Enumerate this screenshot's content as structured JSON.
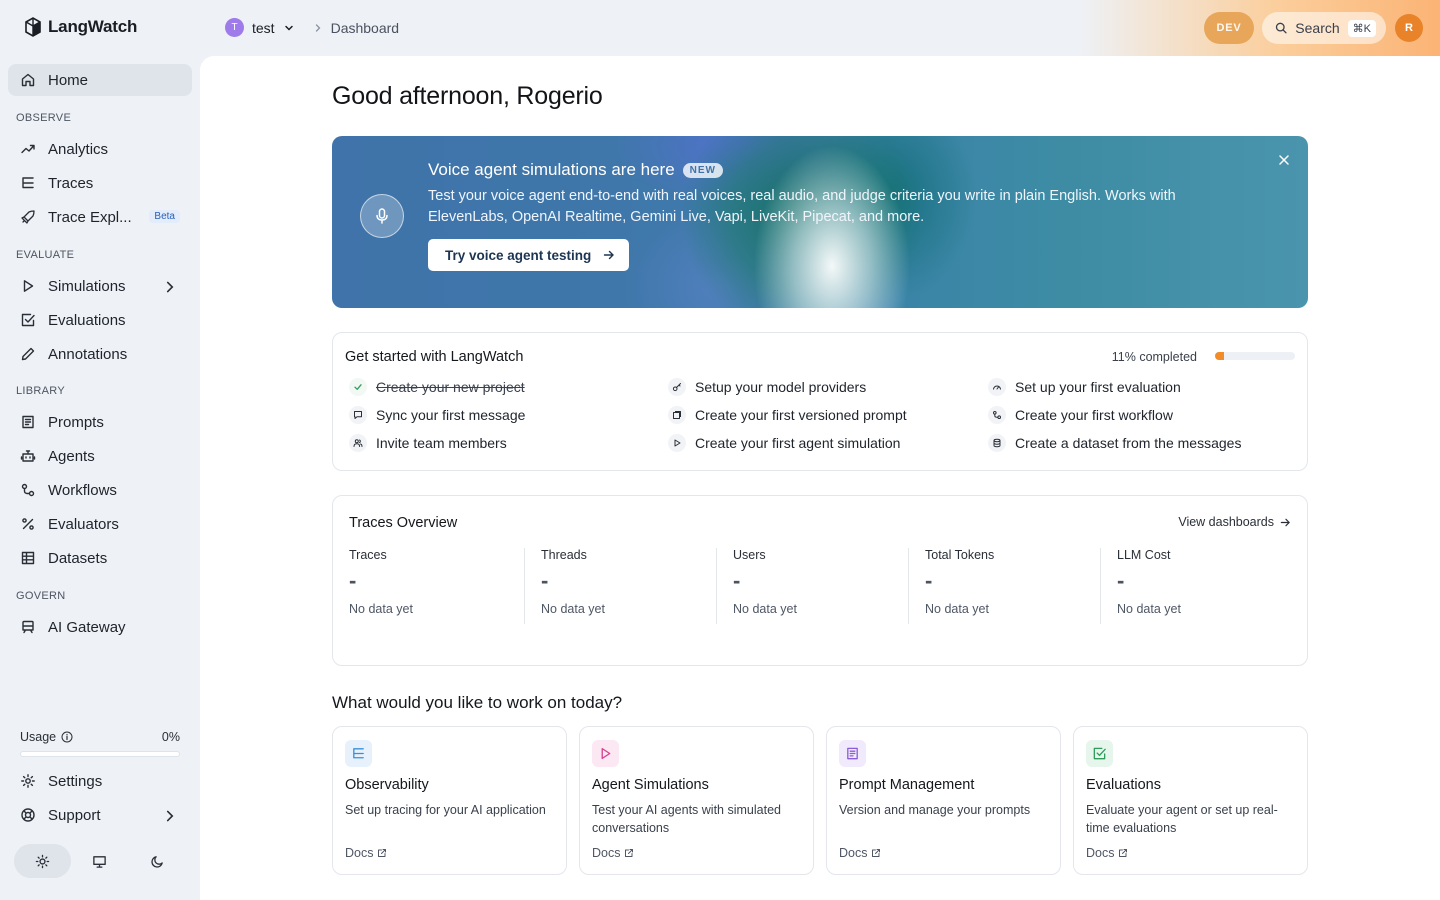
{
  "app": {
    "name": "LangWatch"
  },
  "header": {
    "project_initial": "T",
    "project_name": "test",
    "breadcrumb": "Dashboard",
    "env_badge": "DEV",
    "search_label": "Search",
    "search_shortcut": "⌘K",
    "user_initial": "R"
  },
  "sidebar": {
    "home": "Home",
    "sections": {
      "observe": "OBSERVE",
      "evaluate": "EVALUATE",
      "library": "LIBRARY",
      "govern": "GOVERN"
    },
    "items": {
      "analytics": "Analytics",
      "traces": "Traces",
      "trace_explorer": "Trace Expl...",
      "trace_explorer_badge": "Beta",
      "simulations": "Simulations",
      "evaluations": "Evaluations",
      "annotations": "Annotations",
      "prompts": "Prompts",
      "agents": "Agents",
      "workflows": "Workflows",
      "evaluators": "Evaluators",
      "datasets": "Datasets",
      "ai_gateway": "AI Gateway",
      "settings": "Settings",
      "support": "Support"
    },
    "usage": {
      "label": "Usage",
      "value": "0%",
      "fraction": 0
    },
    "theme": {
      "selected": "light",
      "options": [
        "light",
        "system",
        "dark"
      ]
    }
  },
  "main": {
    "greeting": "Good afternoon, Rogerio",
    "banner": {
      "title": "Voice agent simulations are here",
      "badge": "NEW",
      "text": "Test your voice agent end-to-end with real voices, real audio, and judge criteria you write in plain English. Works with ElevenLabs, OpenAI Realtime, Gemini Live, Vapi, LiveKit, Pipecat, and more.",
      "cta": "Try voice agent testing"
    },
    "get_started": {
      "title": "Get started with LangWatch",
      "progress_label": "11% completed",
      "progress": 0.11,
      "tasks": [
        {
          "label": "Create your new project",
          "done": true,
          "icon": "check-icon"
        },
        {
          "label": "Setup your model providers",
          "done": false,
          "icon": "key-icon"
        },
        {
          "label": "Set up your first evaluation",
          "done": false,
          "icon": "gauge-icon"
        },
        {
          "label": "Sync your first message",
          "done": false,
          "icon": "message-icon"
        },
        {
          "label": "Create your first versioned prompt",
          "done": false,
          "icon": "prompt-icon"
        },
        {
          "label": "Create your first workflow",
          "done": false,
          "icon": "workflow-icon"
        },
        {
          "label": "Invite team members",
          "done": false,
          "icon": "users-icon"
        },
        {
          "label": "Create your first agent simulation",
          "done": false,
          "icon": "play-icon"
        },
        {
          "label": "Create a dataset from the messages",
          "done": false,
          "icon": "database-icon"
        }
      ]
    },
    "traces_overview": {
      "title": "Traces Overview",
      "link": "View dashboards",
      "metrics": [
        {
          "label": "Traces",
          "value": "-",
          "note": "No data yet"
        },
        {
          "label": "Threads",
          "value": "-",
          "note": "No data yet"
        },
        {
          "label": "Users",
          "value": "-",
          "note": "No data yet"
        },
        {
          "label": "Total Tokens",
          "value": "-",
          "note": "No data yet"
        },
        {
          "label": "LLM Cost",
          "value": "-",
          "note": "No data yet"
        }
      ]
    },
    "work_on": {
      "title": "What would you like to work on today?",
      "cards": [
        {
          "title": "Observability",
          "desc": "Set up tracing for your AI application",
          "docs": "Docs",
          "icon": "list-tree-icon",
          "color": "#3b8fd9"
        },
        {
          "title": "Agent Simulations",
          "desc": "Test your AI agents with simulated conversations",
          "docs": "Docs",
          "icon": "play-icon",
          "color": "#d63f8c"
        },
        {
          "title": "Prompt Management",
          "desc": "Version and manage your prompts",
          "docs": "Docs",
          "icon": "book-icon",
          "color": "#8a5cd6"
        },
        {
          "title": "Evaluations",
          "desc": "Evaluate your agent or set up real-time evaluations",
          "docs": "Docs",
          "icon": "check-square-icon",
          "color": "#2f9d5a"
        }
      ]
    }
  }
}
